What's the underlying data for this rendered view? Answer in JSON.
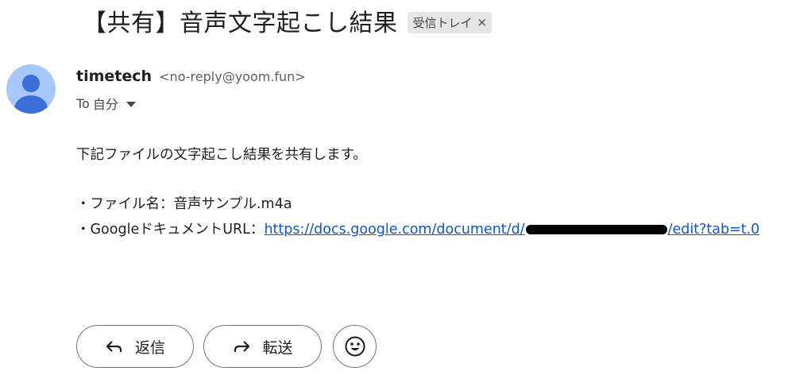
{
  "email": {
    "subject": "【共有】音声文字起こし結果",
    "label_chip": "受信トレイ",
    "label_close": "×",
    "sender_name": "timetech",
    "sender_email": "<no-reply@yoom.fun>",
    "recipient_prefix": "To",
    "recipient_name": "自分",
    "body": {
      "intro": "下記ファイルの文字起こし結果を共有します。",
      "file_line": "・ファイル名：音声サンプル.m4a",
      "doc_label": "・GoogleドキュメントURL：",
      "link_start": "https://docs.google.com/document/d/",
      "link_end": "/edit?tab=t.0"
    }
  },
  "actions": {
    "reply_label": "返信",
    "forward_label": "転送"
  },
  "icons": {
    "avatar": "person-icon",
    "caret": "caret-down-icon",
    "reply": "reply-arrow-icon",
    "forward": "forward-arrow-icon",
    "emoji": "smiley-icon"
  },
  "colors": {
    "link": "#1155cc",
    "avatar_bg": "#a8c7fa",
    "avatar_fg": "#3a6fd8",
    "chip_bg": "#e6e6e6"
  }
}
